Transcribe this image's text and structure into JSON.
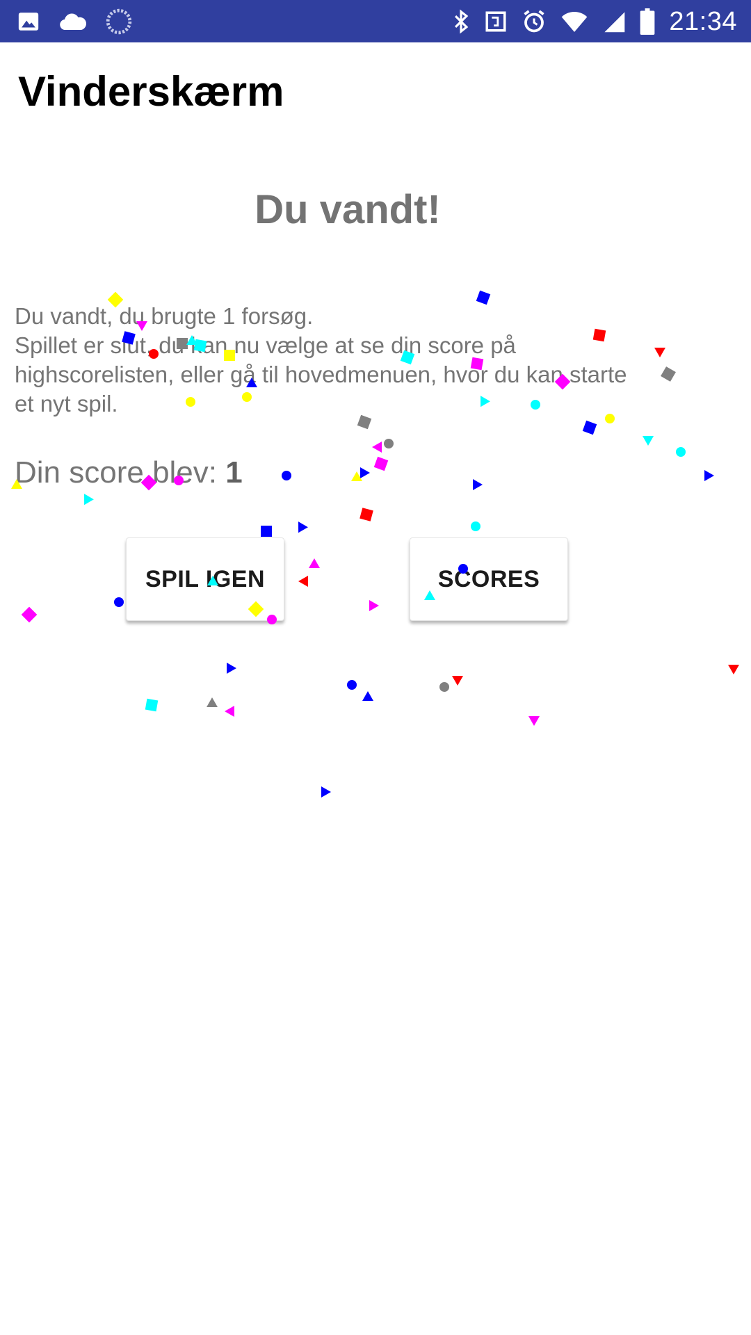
{
  "status_bar": {
    "time": "21:34",
    "left_icons": [
      "image-icon",
      "cloud-icon",
      "sync-icon"
    ],
    "right_icons": [
      "bluetooth-icon",
      "nfc-icon",
      "alarm-icon",
      "wifi-icon",
      "signal-icon",
      "battery-icon"
    ],
    "background": "#303f9f"
  },
  "app_bar": {
    "title": "Vinderskærm"
  },
  "main": {
    "headline": "Du vandt!",
    "message_lines": [
      "Du vandt, du brugte 1 forsøg.",
      "Spillet er slut, du kan nu vælge at se din score på",
      "highscorelisten, eller gå til hovedmenuen, hvor du kan starte",
      "et nyt spil."
    ],
    "score_label": "Din score blev: ",
    "score_value": "1"
  },
  "buttons": {
    "play_again": "SPIL IGEN",
    "scores": "SCORES"
  },
  "confetti_colors": {
    "yellow": "#ffff00",
    "magenta": "#ff00ff",
    "blue": "#0000ff",
    "red": "#ff0000",
    "cyan": "#00ffff",
    "gray": "#808080"
  }
}
